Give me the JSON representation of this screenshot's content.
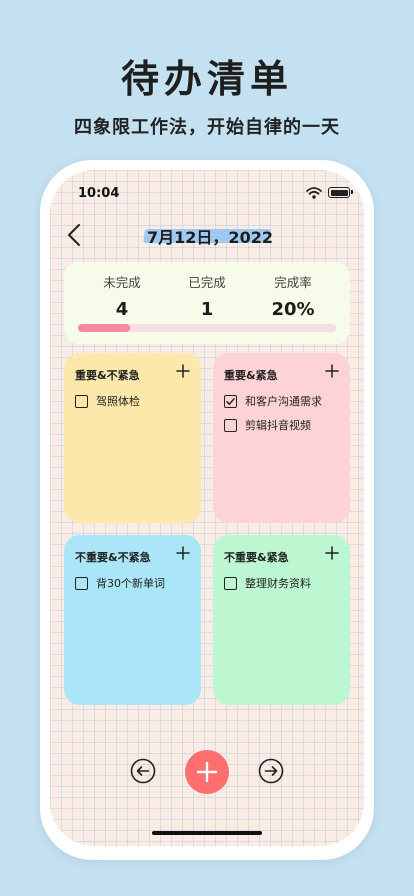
{
  "hero": {
    "title": "待办清单",
    "subtitle": "四象限工作法，开始自律的一天"
  },
  "status_bar": {
    "time": "10:04"
  },
  "header": {
    "date": "7月12日，2022"
  },
  "stats": {
    "pending_label": "未完成",
    "pending_value": "4",
    "done_label": "已完成",
    "done_value": "1",
    "rate_label": "完成率",
    "rate_value": "20%",
    "progress_fraction": 0.2
  },
  "quadrants": [
    {
      "title": "重要&不紧急",
      "color": "#fde8ac",
      "tasks": [
        {
          "label": "驾照体检",
          "checked": false
        }
      ]
    },
    {
      "title": "重要&紧急",
      "color": "#fed3d6",
      "tasks": [
        {
          "label": "和客户沟通需求",
          "checked": true
        },
        {
          "label": "剪辑抖音视频",
          "checked": false
        }
      ]
    },
    {
      "title": "不重要&不紧急",
      "color": "#abe6f8",
      "tasks": [
        {
          "label": "背30个新单词",
          "checked": false
        }
      ]
    },
    {
      "title": "不重要&紧急",
      "color": "#bdf7d2",
      "tasks": [
        {
          "label": "整理财务资料",
          "checked": false
        }
      ]
    }
  ],
  "colors": {
    "accent": "#ff6f70",
    "progress": "#f4899f",
    "stats_bg": "#f6fbea"
  },
  "icons": {
    "back": "chevron-left-icon",
    "add": "plus-icon",
    "prev": "arrow-left-circle-icon",
    "next": "arrow-right-circle-icon"
  }
}
